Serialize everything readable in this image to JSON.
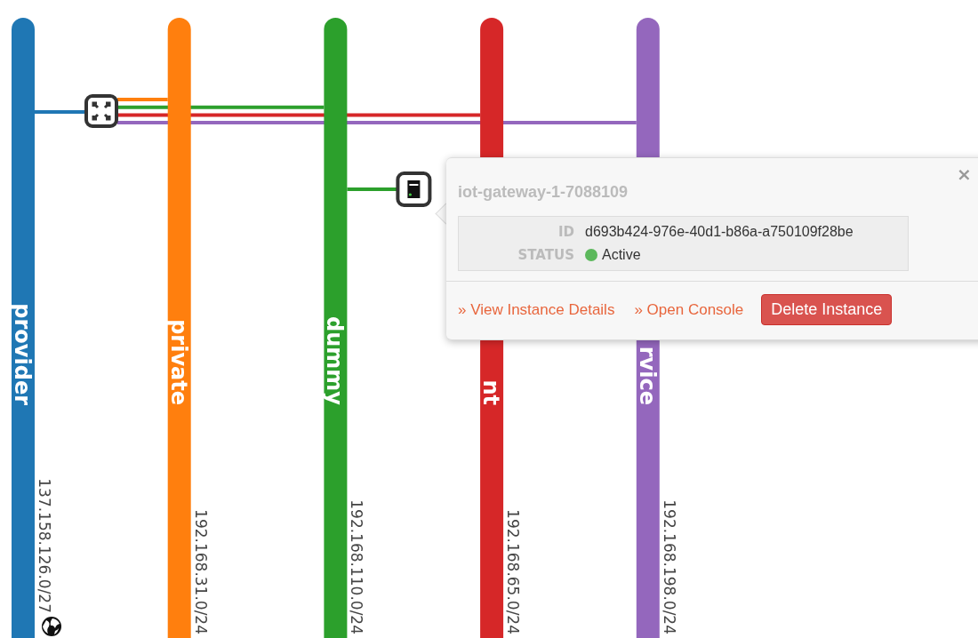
{
  "networks": [
    {
      "name": "provider",
      "cidr": "137.158.126.0/27",
      "color": "#1f77b4",
      "external": true
    },
    {
      "name": "private",
      "cidr": "192.168.31.0/24",
      "color": "#ff7f0e",
      "external": false
    },
    {
      "name": "dummy",
      "cidr": "192.168.110.0/24",
      "color": "#2ca02c",
      "external": false,
      "instances": [
        {
          "kind": "server"
        }
      ]
    },
    {
      "name": "nt",
      "cidr": "192.168.65.0/24",
      "color": "#d62728",
      "external": false
    },
    {
      "name": "rvice",
      "cidr": "192.168.198.0/24",
      "color": "#9467bd",
      "external": false
    }
  ],
  "popup": {
    "title": "iot-gateway-1-7088109",
    "close": "×",
    "fields": [
      {
        "label": "ID",
        "value": "d693b424-976e-40d1-b86a-a750109f28be",
        "kind": "text"
      },
      {
        "label": "STATUS",
        "value": "Active",
        "kind": "status",
        "active": true
      }
    ],
    "links": [
      "» View Instance Details",
      "» Open Console"
    ],
    "button": "Delete Instance"
  }
}
